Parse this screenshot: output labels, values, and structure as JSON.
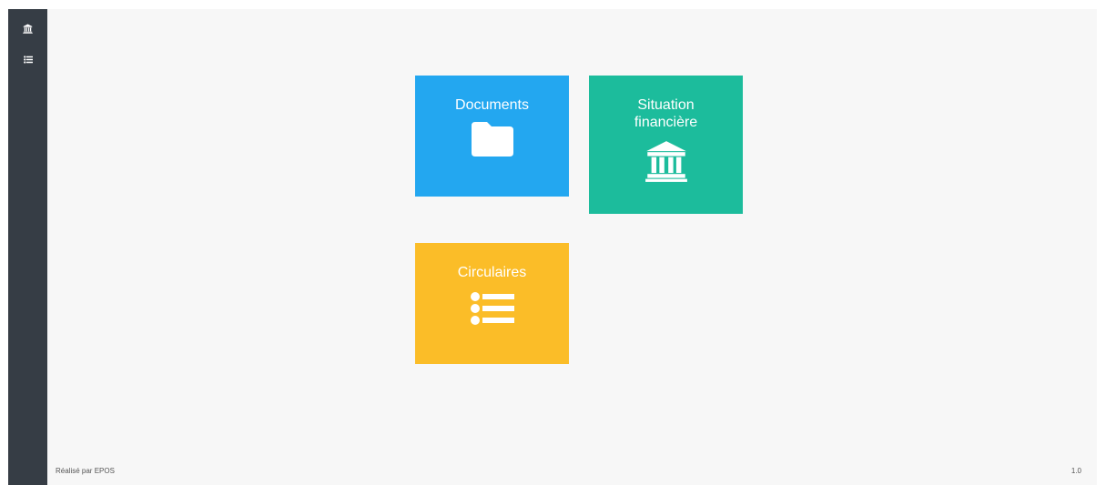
{
  "sidebar": {
    "items": [
      {
        "icon": "bank-icon"
      },
      {
        "icon": "list-icon"
      }
    ]
  },
  "tiles": [
    {
      "label": "Documents",
      "icon": "folder-icon",
      "color": "#23a7f0"
    },
    {
      "label_line1": "Situation",
      "label_line2": "financière",
      "icon": "bank-icon",
      "color": "#1cbc9c"
    },
    {
      "label": "Circulaires",
      "icon": "list-icon",
      "color": "#fbbd28"
    }
  ],
  "footer": {
    "credit": "Réalisé par EPOS",
    "version": "1.0"
  },
  "colors": {
    "sidebar": "#363d45",
    "background": "#f7f7f7"
  }
}
